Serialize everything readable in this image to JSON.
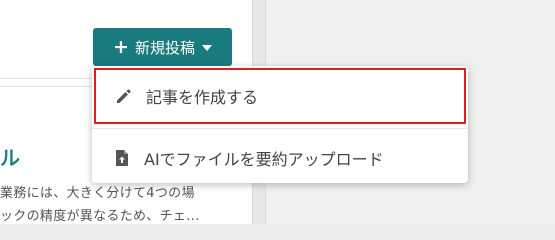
{
  "header": {
    "new_post_button": {
      "plus": "+",
      "label": "新規投稿"
    }
  },
  "dropdown": {
    "items": [
      {
        "label": "記事を作成する",
        "icon": "pencil-icon"
      },
      {
        "label": "AIでファイルを要約アップロード",
        "icon": "file-upload-icon"
      }
    ]
  },
  "card": {
    "title_fragment": "ル",
    "text_line1": "業務には、大きく分けて4つの場",
    "text_line2": "ックの精度が異なるため、チェ..."
  },
  "colors": {
    "accent": "#1a7b7e",
    "highlight_border": "#e01e1e",
    "title_color": "#1f7f83"
  }
}
